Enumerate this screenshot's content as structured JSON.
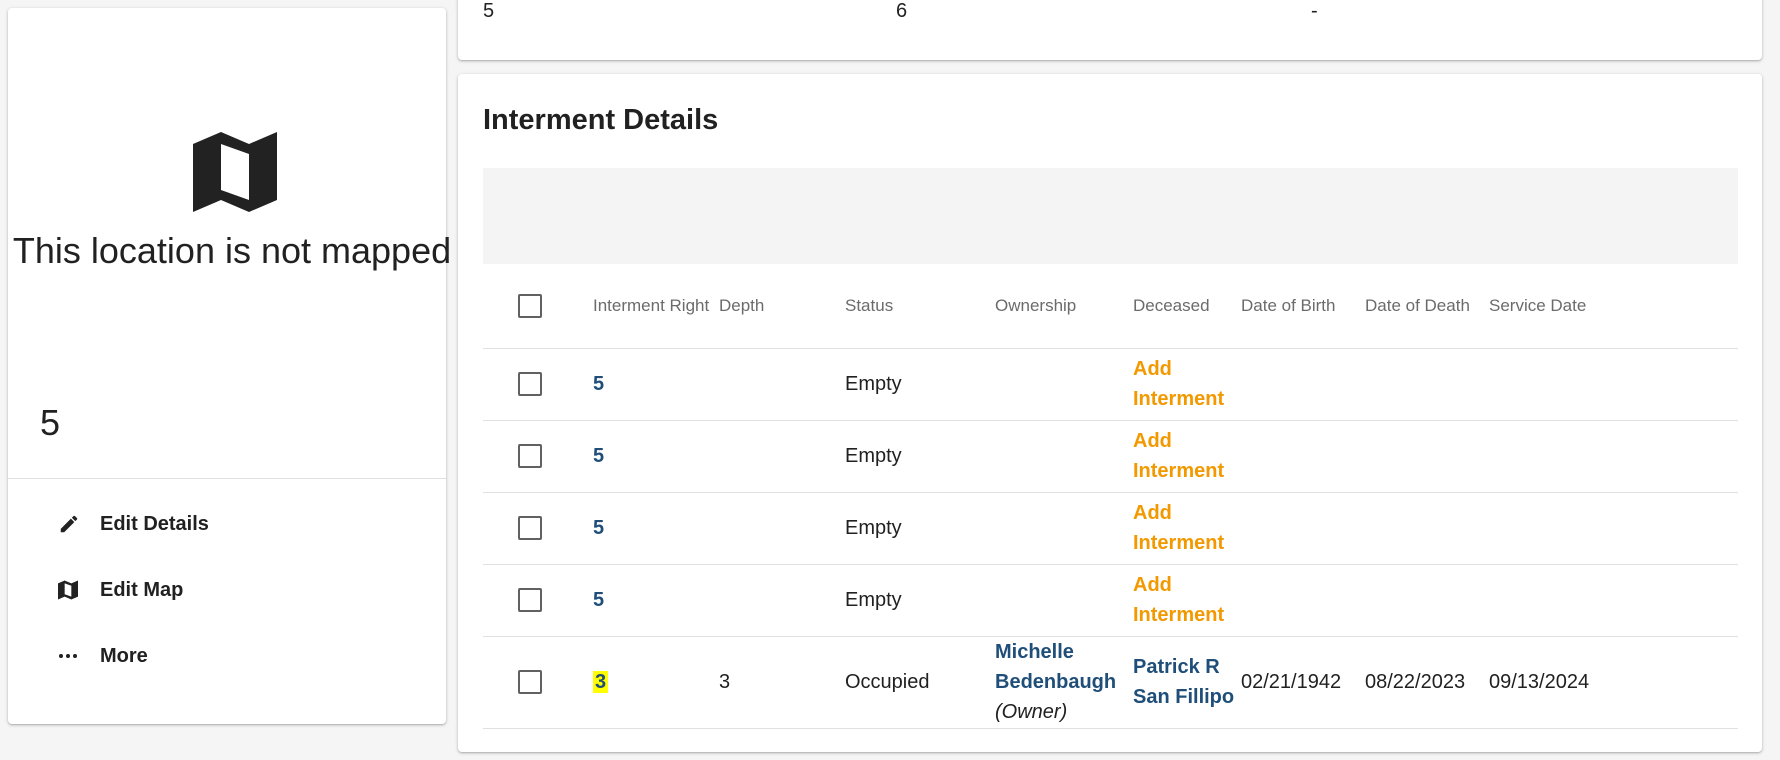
{
  "left_panel": {
    "not_mapped_text": "This location is not mapped",
    "plot_number": "5",
    "actions": [
      {
        "label": "Edit Details",
        "icon": "pencil-icon"
      },
      {
        "label": "Edit Map",
        "icon": "map-icon"
      },
      {
        "label": "More",
        "icon": "more-horizontal-icon"
      }
    ]
  },
  "top_card": {
    "cells": [
      "5",
      "6",
      "-"
    ]
  },
  "interments": {
    "title": "Interment Details",
    "columns": [
      "Interment Right",
      "Depth",
      "Status",
      "Ownership",
      "Deceased",
      "Date of Birth",
      "Date of Death",
      "Service Date"
    ],
    "add_interment_label": [
      "Add",
      "Interment"
    ],
    "rows": [
      {
        "right": "5",
        "depth": "",
        "status": "Empty",
        "owner_name": "",
        "owner_role": "",
        "deceased": "",
        "dob": "",
        "dod": "",
        "service": ""
      },
      {
        "right": "5",
        "depth": "",
        "status": "Empty",
        "owner_name": "",
        "owner_role": "",
        "deceased": "",
        "dob": "",
        "dod": "",
        "service": ""
      },
      {
        "right": "5",
        "depth": "",
        "status": "Empty",
        "owner_name": "",
        "owner_role": "",
        "deceased": "",
        "dob": "",
        "dod": "",
        "service": ""
      },
      {
        "right": "5",
        "depth": "",
        "status": "Empty",
        "owner_name": "",
        "owner_role": "",
        "deceased": "",
        "dob": "",
        "dod": "",
        "service": ""
      },
      {
        "right": "3",
        "depth": "3",
        "status": "Occupied",
        "owner_name": "Michelle Bedenbaugh",
        "owner_role": "(Owner)",
        "deceased": "Patrick R San Fillipo",
        "dob": "02/21/1942",
        "dod": "08/22/2023",
        "service": "09/13/2024"
      }
    ]
  },
  "colors": {
    "link_blue": "#1f4e79",
    "add_orange": "#f29900",
    "highlight": "#ffff00"
  }
}
